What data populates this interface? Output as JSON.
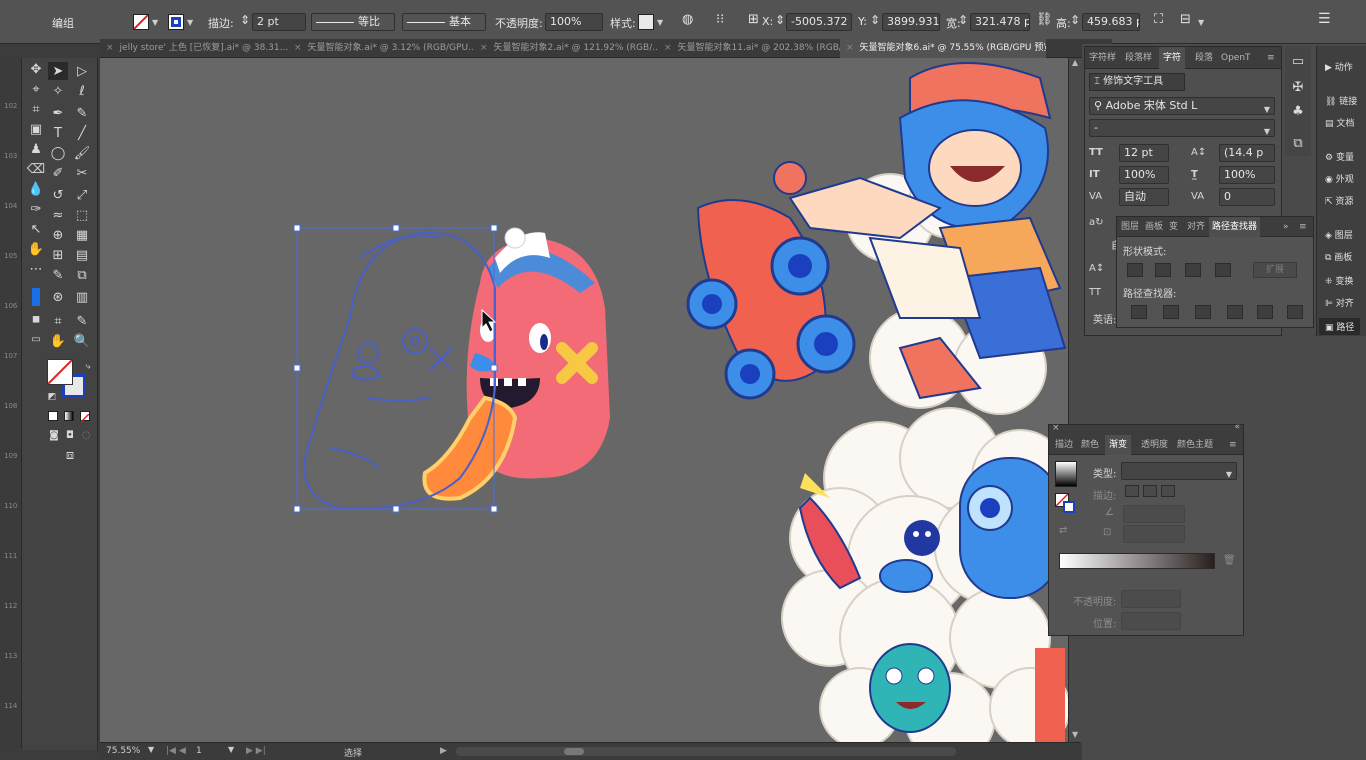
{
  "control_bar": {
    "mode_label": "编组",
    "stroke_label": "描边:",
    "stroke_value": "2 pt",
    "profile_value": "等比",
    "brush_value": "基本",
    "opacity_label": "不透明度:",
    "opacity_value": "100%",
    "style_label": "样式:",
    "x_label": "X:",
    "x_value": "-5005.372",
    "y_label": "Y:",
    "y_value": "3899.931",
    "w_label": "宽:",
    "w_value": "321.478 p",
    "h_label": "高:",
    "h_value": "459.683 p"
  },
  "tabs": [
    {
      "label": "jelly store' 上色 [已恢复].ai* @ 38.31..."
    },
    {
      "label": "矢量智能对象.ai* @ 3.12% (RGB/GPU..."
    },
    {
      "label": "矢量智能对象2.ai* @ 121.92% (RGB/..."
    },
    {
      "label": "矢量智能对象11.ai* @ 202.38% (RGB/..."
    },
    {
      "label": "矢量智能对象6.ai* @ 75.55% (RGB/GPU 预览)"
    }
  ],
  "ruler_marks": [
    "102",
    "103",
    "104",
    "105",
    "106",
    "107",
    "108",
    "109",
    "110",
    "111",
    "112",
    "113",
    "114"
  ],
  "status": {
    "zoom": "75.55%",
    "page": "1",
    "mode": "选择"
  },
  "char_panel": {
    "tabs": [
      "字符样",
      "段落样",
      "字符",
      "段落",
      "OpenT"
    ],
    "touch_tool": "修饰文字工具",
    "font_family": "Adobe 宋体 Std L",
    "font_style": "-",
    "size": "12 pt",
    "leading": "(14.4 p",
    "vscale": "100%",
    "hscale": "100%",
    "kerning": "自动",
    "tracking": "0",
    "language_label": "英语:",
    "side_labels": [
      "自",
      "自"
    ]
  },
  "right_icons": [
    {
      "label": "动作"
    },
    {
      "label": "链接"
    },
    {
      "label": "文档"
    },
    {
      "label": "变量"
    },
    {
      "label": "外观"
    },
    {
      "label": "资源"
    },
    {
      "label": "图层"
    },
    {
      "label": "画板"
    },
    {
      "label": "变换"
    },
    {
      "label": "对齐"
    },
    {
      "label": "路径"
    }
  ],
  "pathfinder": {
    "tabs": [
      "图层",
      "画板",
      "变",
      "对齐",
      "路径查找器"
    ],
    "shape_modes": "形状模式:",
    "expand": "扩展",
    "pathfinders": "路径查找器:"
  },
  "gradient": {
    "tabs": [
      "描边",
      "颜色",
      "渐变",
      "透明度",
      "颜色主题"
    ],
    "type_label": "类型:",
    "stroke_label": "描边:",
    "opacity_label": "不透明度:",
    "location_label": "位置:"
  },
  "colors": {
    "accent": "#1a3fbf",
    "canvas": "#676767",
    "panel": "#535353"
  }
}
